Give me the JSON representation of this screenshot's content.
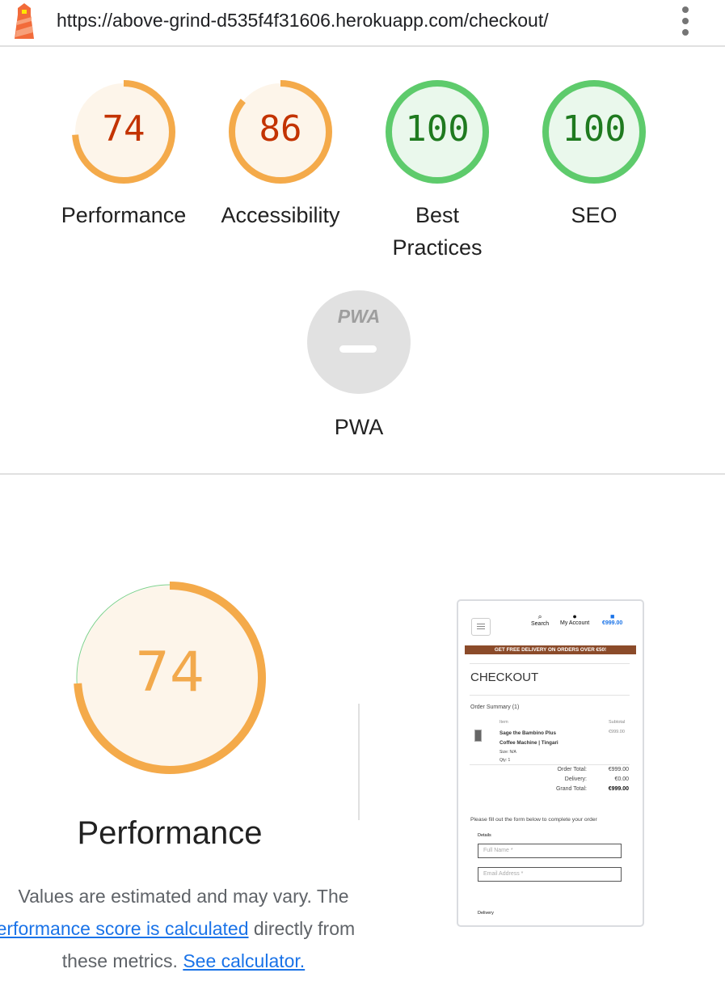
{
  "topbar": {
    "url": "https://above-grind-d535f4f31606.herokuapp.com/checkout/",
    "logo_icon": "lighthouse-icon",
    "menu_icon": "kebab-menu-icon"
  },
  "colors": {
    "average_stroke": "#f4aa4a",
    "average_fill": "#fdf5ea",
    "average_text": "#c33300",
    "pass_stroke": "#5ecb6c",
    "pass_fill": "#eaf8ec",
    "pass_text": "#1f7a1f",
    "pwa_fill": "#e1e1e1",
    "link": "#1a73e8"
  },
  "scores": [
    {
      "label": "Performance",
      "value": "74",
      "fraction": 0.74,
      "status": "average"
    },
    {
      "label": "Accessibility",
      "value": "86",
      "fraction": 0.86,
      "status": "average"
    },
    {
      "label": "Best Practices",
      "value": "100",
      "fraction": 1.0,
      "status": "pass"
    },
    {
      "label": "SEO",
      "value": "100",
      "fraction": 1.0,
      "status": "pass"
    }
  ],
  "pwa": {
    "badge": "PWA",
    "label": "PWA",
    "icon": "pwa-badge-icon"
  },
  "performance_detail": {
    "score": "74",
    "fraction": 0.74,
    "title": "Performance",
    "desc_prefix": "Values are estimated and may vary. The ",
    "desc_link1": "performance score is calculated",
    "desc_middle": " directly from these metrics. ",
    "desc_link2": "See calculator."
  },
  "screenshot": {
    "menu_icon": "hamburger-icon",
    "nav": {
      "search": "Search",
      "account": "My Account",
      "cart": "€999.00"
    },
    "banner": "GET FREE DELIVERY ON ORDERS OVER €50!",
    "heading": "CHECKOUT",
    "summary": "Order Summary (1)",
    "col_item": "Item",
    "col_subtotal": "Subtotal",
    "product_name_1": "Sage the Bambino Plus",
    "product_name_2": "Coffee Machine | Tingari",
    "product_price": "€999.00",
    "size": "Size: N/A",
    "qty": "Qty: 1",
    "order_total_label": "Order Total:",
    "order_total": "€999.00",
    "delivery_label": "Delivery:",
    "delivery": "€0.00",
    "grand_total_label": "Grand Total:",
    "grand_total": "€999.00",
    "form_note": "Please fill out the form below to complete your order",
    "details": "Details",
    "full_name_placeholder": "Full Name *",
    "email_placeholder": "Email Address *",
    "delivery_section": "Delivery"
  }
}
